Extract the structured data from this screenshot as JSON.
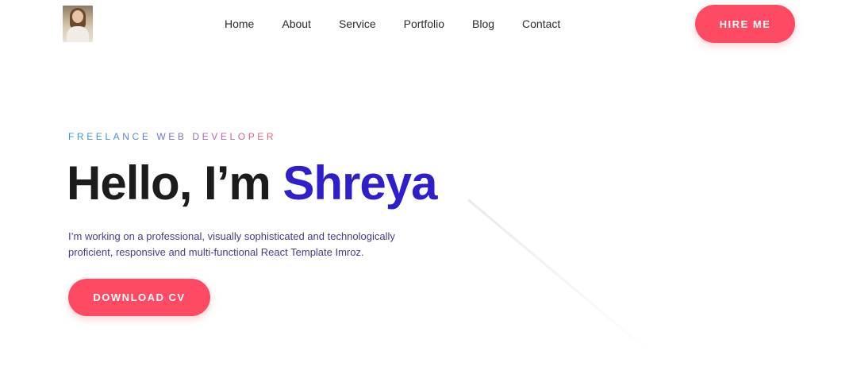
{
  "header": {
    "logo_alt": "profile photo",
    "nav": [
      "Home",
      "About",
      "Service",
      "Portfolio",
      "Blog",
      "Contact"
    ],
    "hire_label": "HIRE ME"
  },
  "hero": {
    "tagline": "FREELANCE WEB DEVELOPER",
    "greeting": "Hello, I’m ",
    "name": "Shreya",
    "description": "I’m working on a professional, visually sophisticated and technologically proficient, responsive and multi-functional React Template Imroz.",
    "cta_label": "DOWNLOAD CV"
  },
  "colors": {
    "accent": "#ff4a63",
    "name": "#2f1ec9",
    "tagline_start": "#2a9fd6",
    "tagline_end": "#ff5a7a"
  }
}
